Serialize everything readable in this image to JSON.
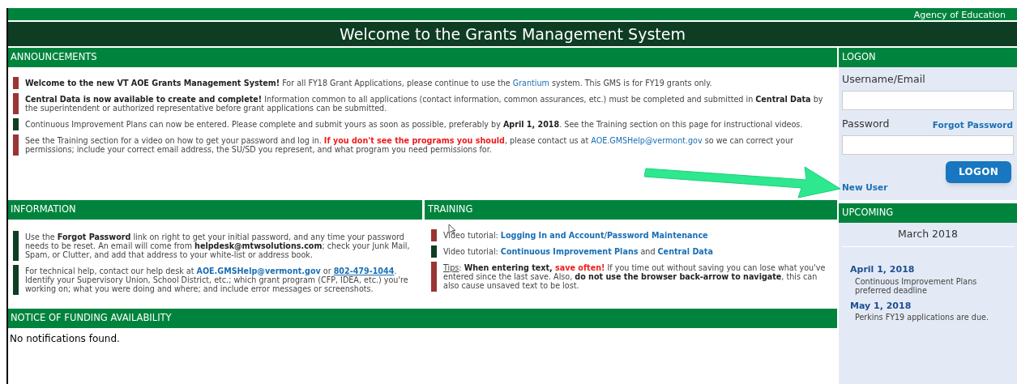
{
  "agency": "Agency of Education",
  "title": "Welcome to the Grants Management System",
  "announcements": {
    "heading": "ANNOUNCEMENTS",
    "items": [
      {
        "color": "#9b3535",
        "segments": [
          {
            "kind": "bold",
            "text": "Welcome to the new VT AOE Grants Management System!"
          },
          {
            "kind": "text",
            "text": " For all FY18 Grant Applications, please continue to use the "
          },
          {
            "kind": "link",
            "text": "Grantium"
          },
          {
            "kind": "text",
            "text": " system. This GMS is for FY19 grants only."
          }
        ]
      },
      {
        "color": "#9b3535",
        "segments": [
          {
            "kind": "bold",
            "text": "Central Data is now available to create and complete!"
          },
          {
            "kind": "text",
            "text": " Information common to all applications (contact information, common assurances, etc.) must be completed and submitted in "
          },
          {
            "kind": "bold",
            "text": "Central Data"
          },
          {
            "kind": "text",
            "text": " by the superintendent or authorized representative before grant applications can be submitted."
          }
        ]
      },
      {
        "color": "#0f3d24",
        "segments": [
          {
            "kind": "text",
            "text": "Continuous Improvement Plans can now be entered. Please complete and submit yours as soon as possible, preferably by "
          },
          {
            "kind": "bold",
            "text": "April 1, 2018"
          },
          {
            "kind": "text",
            "text": ". See the Training section on this page for instructional videos."
          }
        ]
      },
      {
        "color": "#9b3535",
        "segments": [
          {
            "kind": "text",
            "text": "See the Training section for a video on how to get your password and log in. "
          },
          {
            "kind": "alert",
            "text": "If you don't see the programs you should"
          },
          {
            "kind": "text",
            "text": ", please contact us at "
          },
          {
            "kind": "link",
            "text": "AOE.GMSHelp@vermont.gov"
          },
          {
            "kind": "text",
            "text": " so we can correct your permissions; include your correct email address, the SU/SD you represent, and what program you need permissions for."
          }
        ]
      }
    ]
  },
  "logon": {
    "heading": "LOGON",
    "username_label": "Username/Email",
    "password_label": "Password",
    "forgot": "Forgot Password",
    "button": "LOGON",
    "new_user": "New User"
  },
  "information": {
    "heading": "INFORMATION",
    "items": [
      {
        "color": "#0f3d24",
        "segments": [
          {
            "kind": "text",
            "text": "Use the "
          },
          {
            "kind": "bold",
            "text": "Forgot Password"
          },
          {
            "kind": "text",
            "text": " link on right to get your initial password, and any time your password needs to be reset. An email will come from "
          },
          {
            "kind": "bold",
            "text": "helpdesk@mtwsolutions.com"
          },
          {
            "kind": "text",
            "text": "; check your Junk Mail, Spam, or Clutter, and add that address to your white-list or address book."
          }
        ]
      },
      {
        "color": "#0f3d24",
        "segments": [
          {
            "kind": "text",
            "text": "For technical help, contact our help desk at "
          },
          {
            "kind": "boldlink",
            "text": "AOE.GMSHelp@vermont.gov"
          },
          {
            "kind": "text",
            "text": " or "
          },
          {
            "kind": "underlink",
            "text": "802-479-1044"
          },
          {
            "kind": "text",
            "text": ". Identify your Supervisory Union, School District, etc.; which grant program (CFP, IDEA, etc.) you're working on; what you were doing and where; and include error messages or screenshots."
          }
        ]
      }
    ]
  },
  "training": {
    "heading": "TRAINING",
    "items": [
      {
        "color": "#9b3535",
        "segments": [
          {
            "kind": "text",
            "text": "Video tutorial: "
          },
          {
            "kind": "boldlink",
            "text": "Logging In and Account/Password Maintenance"
          }
        ]
      },
      {
        "color": "#0f3d24",
        "segments": [
          {
            "kind": "text",
            "text": "Video tutorial: "
          },
          {
            "kind": "boldlink",
            "text": "Continuous Improvement Plans"
          },
          {
            "kind": "text",
            "text": " and "
          },
          {
            "kind": "boldlink",
            "text": "Central Data"
          }
        ]
      },
      {
        "color": "#9b3535",
        "segments": [
          {
            "kind": "underline",
            "text": "Tips"
          },
          {
            "kind": "text",
            "text": ": "
          },
          {
            "kind": "bold",
            "text": "When entering text, "
          },
          {
            "kind": "alert",
            "text": "save often!"
          },
          {
            "kind": "text",
            "text": " If you time out without saving you can lose what you've entered since the last save. Also, "
          },
          {
            "kind": "bold",
            "text": "do not use the browser back-arrow to navigate"
          },
          {
            "kind": "text",
            "text": ", this can also cause unsaved text to be lost."
          }
        ]
      }
    ]
  },
  "upcoming": {
    "heading": "UPCOMING",
    "month": "March 2018",
    "events": [
      {
        "date": "April 1, 2018",
        "text": "Continuous Improvement Plans preferred deadline"
      },
      {
        "date": "May 1, 2018",
        "text": "Perkins FY19 applications are due."
      }
    ]
  },
  "funding": {
    "heading": "NOTICE OF FUNDING AVAILABILITY",
    "message": "No notifications found."
  }
}
